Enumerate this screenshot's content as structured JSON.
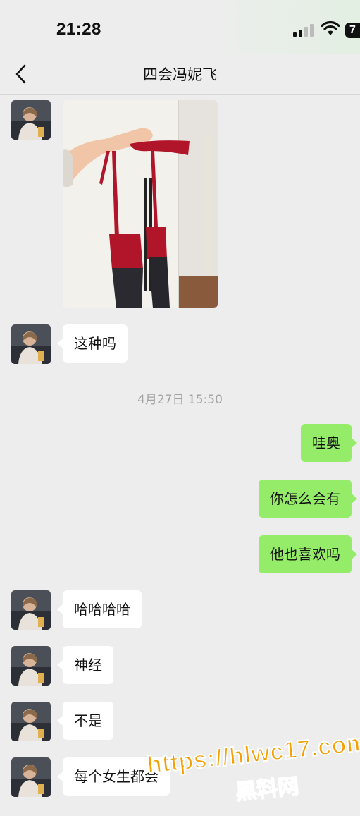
{
  "status_bar": {
    "time": "21:28",
    "battery": "7"
  },
  "header": {
    "title": "四会冯妮飞"
  },
  "messages": {
    "m2": "这种吗",
    "timestamp": "4月27日 15:50",
    "m3": "哇奥",
    "m4": "你怎么会有",
    "m5": "他也喜欢吗",
    "m6": "哈哈哈哈",
    "m7": "神经",
    "m8": "不是",
    "m9": "每个女生都会"
  },
  "watermark": {
    "url": "https://hlwc17.com",
    "text": "黑料网"
  },
  "colors": {
    "background": "#ededed",
    "outgoing_bubble": "#95ec69",
    "incoming_bubble": "#ffffff"
  }
}
